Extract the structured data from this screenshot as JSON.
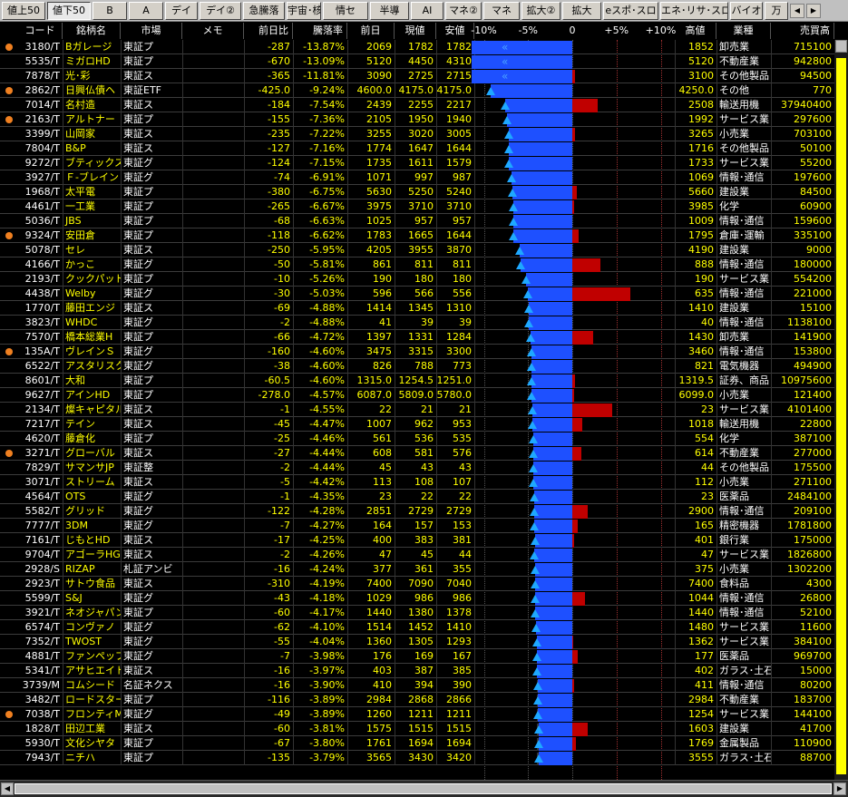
{
  "tabs": [
    "値上50",
    "値下50",
    "B",
    "A",
    "デイ",
    "デイ②",
    "急騰落",
    "宇宙･核",
    "情セ",
    "半導",
    "AI",
    "マネ②",
    "マネ",
    "拡大②",
    "拡大",
    "eスポ･スロ",
    "エネ･リサ･スロ",
    "バイオ",
    "万"
  ],
  "columns": {
    "code": "コード",
    "name": "銘柄名",
    "market": "市場",
    "memo": "メモ",
    "change": "前日比",
    "rate": "騰落率",
    "prev": "前日",
    "now": "現値",
    "low": "安値",
    "axis": [
      "-10%",
      "-5%",
      "0",
      "+5%",
      "+10%"
    ],
    "high": "高値",
    "industry": "業種",
    "volume": "売買高"
  },
  "rows": [
    {
      "dot": true,
      "code": "3180/T",
      "name": "Bガレージ",
      "market": "東証プ",
      "change": "-287",
      "rate": "-13.87%",
      "prev": "2069",
      "now": "1782",
      "low": "1782",
      "high": "1852",
      "industry": "卸売業",
      "volume": "715100",
      "pct": -13.87,
      "hpct": -10.49,
      "mark": "dbl"
    },
    {
      "dot": false,
      "code": "5535/T",
      "name": "ミガロHD",
      "market": "東証プ",
      "change": "-670",
      "rate": "-13.09%",
      "prev": "5120",
      "now": "4450",
      "low": "4310",
      "high": "5120",
      "industry": "不動産業",
      "volume": "942800",
      "pct": -13.09,
      "hpct": 0,
      "mark": "dbl"
    },
    {
      "dot": false,
      "code": "7878/T",
      "name": "光･彩",
      "market": "東証ス",
      "change": "-365",
      "rate": "-11.81%",
      "prev": "3090",
      "now": "2725",
      "low": "2715",
      "high": "3100",
      "industry": "その他製品",
      "volume": "94500",
      "pct": -11.81,
      "hpct": 0.32,
      "mark": "dbl"
    },
    {
      "dot": true,
      "code": "2862/T",
      "name": "日興仏債ヘ",
      "market": "東証ETF",
      "change": "-425.0",
      "rate": "-9.24%",
      "prev": "4600.0",
      "now": "4175.0",
      "low": "4175.0",
      "high": "4250.0",
      "industry": "その他",
      "volume": "770",
      "pct": -9.24,
      "hpct": -7.61,
      "mark": "tri"
    },
    {
      "dot": false,
      "code": "7014/T",
      "name": "名村造",
      "market": "東証ス",
      "change": "-184",
      "rate": "-7.54%",
      "prev": "2439",
      "now": "2255",
      "low": "2217",
      "high": "2508",
      "industry": "輸送用機",
      "volume": "37940400",
      "pct": -7.54,
      "hpct": 2.83,
      "mark": "tri"
    },
    {
      "dot": true,
      "code": "2163/T",
      "name": "アルトナー",
      "market": "東証プ",
      "change": "-155",
      "rate": "-7.36%",
      "prev": "2105",
      "now": "1950",
      "low": "1940",
      "high": "1992",
      "industry": "サービス業",
      "volume": "297600",
      "pct": -7.36,
      "hpct": -5.37,
      "mark": "tri"
    },
    {
      "dot": false,
      "code": "3399/T",
      "name": "山岡家",
      "market": "東証ス",
      "change": "-235",
      "rate": "-7.22%",
      "prev": "3255",
      "now": "3020",
      "low": "3005",
      "high": "3265",
      "industry": "小売業",
      "volume": "703100",
      "pct": -7.22,
      "hpct": 0.31,
      "mark": "tri"
    },
    {
      "dot": false,
      "code": "7804/T",
      "name": "B&P",
      "market": "東証ス",
      "change": "-127",
      "rate": "-7.16%",
      "prev": "1774",
      "now": "1647",
      "low": "1644",
      "high": "1716",
      "industry": "その他製品",
      "volume": "50100",
      "pct": -7.16,
      "hpct": -3.27,
      "mark": "tri"
    },
    {
      "dot": false,
      "code": "9272/T",
      "name": "ブティックス",
      "market": "東証グ",
      "change": "-124",
      "rate": "-7.15%",
      "prev": "1735",
      "now": "1611",
      "low": "1579",
      "high": "1733",
      "industry": "サービス業",
      "volume": "55200",
      "pct": -7.15,
      "hpct": -0.12,
      "mark": "tri"
    },
    {
      "dot": false,
      "code": "3927/T",
      "name": "Ｆ-ブレイン",
      "market": "東証グ",
      "change": "-74",
      "rate": "-6.91%",
      "prev": "1071",
      "now": "997",
      "low": "987",
      "high": "1069",
      "industry": "情報･通信",
      "volume": "197600",
      "pct": -6.91,
      "hpct": -0.19,
      "mark": "tri"
    },
    {
      "dot": false,
      "code": "1968/T",
      "name": "太平電",
      "market": "東証プ",
      "change": "-380",
      "rate": "-6.75%",
      "prev": "5630",
      "now": "5250",
      "low": "5240",
      "high": "5660",
      "industry": "建設業",
      "volume": "84500",
      "pct": -6.75,
      "hpct": 0.53,
      "mark": "tri"
    },
    {
      "dot": false,
      "code": "4461/T",
      "name": "一工業",
      "market": "東証プ",
      "change": "-265",
      "rate": "-6.67%",
      "prev": "3975",
      "now": "3710",
      "low": "3710",
      "high": "3985",
      "industry": "化学",
      "volume": "60900",
      "pct": -6.67,
      "hpct": 0.25,
      "mark": "tri"
    },
    {
      "dot": false,
      "code": "5036/T",
      "name": "JBS",
      "market": "東証プ",
      "change": "-68",
      "rate": "-6.63%",
      "prev": "1025",
      "now": "957",
      "low": "957",
      "high": "1009",
      "industry": "情報･通信",
      "volume": "159600",
      "pct": -6.63,
      "hpct": -1.56,
      "mark": "tri"
    },
    {
      "dot": true,
      "code": "9324/T",
      "name": "安田倉",
      "market": "東証プ",
      "change": "-118",
      "rate": "-6.62%",
      "prev": "1783",
      "now": "1665",
      "low": "1644",
      "high": "1795",
      "industry": "倉庫･運輸",
      "volume": "335100",
      "pct": -6.62,
      "hpct": 0.67,
      "mark": "tri"
    },
    {
      "dot": false,
      "code": "5078/T",
      "name": "セレ",
      "market": "東証ス",
      "change": "-250",
      "rate": "-5.95%",
      "prev": "4205",
      "now": "3955",
      "low": "3870",
      "high": "4190",
      "industry": "建設業",
      "volume": "9000",
      "pct": -5.95,
      "hpct": -0.36,
      "mark": "tri"
    },
    {
      "dot": false,
      "code": "4166/T",
      "name": "かっこ",
      "market": "東証グ",
      "change": "-50",
      "rate": "-5.81%",
      "prev": "861",
      "now": "811",
      "low": "811",
      "high": "888",
      "industry": "情報･通信",
      "volume": "180000",
      "pct": -5.81,
      "hpct": 3.14,
      "mark": "tri"
    },
    {
      "dot": false,
      "code": "2193/T",
      "name": "クックパッド",
      "market": "東証プ",
      "change": "-10",
      "rate": "-5.26%",
      "prev": "190",
      "now": "180",
      "low": "180",
      "high": "190",
      "industry": "サービス業",
      "volume": "554200",
      "pct": -5.26,
      "hpct": 0,
      "mark": "tri"
    },
    {
      "dot": false,
      "code": "4438/T",
      "name": "Welby",
      "market": "東証グ",
      "change": "-30",
      "rate": "-5.03%",
      "prev": "596",
      "now": "566",
      "low": "556",
      "high": "635",
      "industry": "情報･通信",
      "volume": "221000",
      "pct": -5.03,
      "hpct": 6.54,
      "mark": "tri"
    },
    {
      "dot": false,
      "code": "1770/T",
      "name": "藤田エンジ",
      "market": "東証ス",
      "change": "-69",
      "rate": "-4.88%",
      "prev": "1414",
      "now": "1345",
      "low": "1310",
      "high": "1410",
      "industry": "建設業",
      "volume": "15100",
      "pct": -4.88,
      "hpct": -0.28,
      "mark": "tri"
    },
    {
      "dot": false,
      "code": "3823/T",
      "name": "WHDC",
      "market": "東証グ",
      "change": "-2",
      "rate": "-4.88%",
      "prev": "41",
      "now": "39",
      "low": "39",
      "high": "40",
      "industry": "情報･通信",
      "volume": "1138100",
      "pct": -4.88,
      "hpct": -2.44,
      "mark": "tri"
    },
    {
      "dot": false,
      "code": "7570/T",
      "name": "橋本総業H",
      "market": "東証プ",
      "change": "-66",
      "rate": "-4.72%",
      "prev": "1397",
      "now": "1331",
      "low": "1284",
      "high": "1430",
      "industry": "卸売業",
      "volume": "141900",
      "pct": -4.72,
      "hpct": 2.36,
      "mark": "tri"
    },
    {
      "dot": true,
      "code": "135A/T",
      "name": "ヴレインＳ",
      "market": "東証グ",
      "change": "-160",
      "rate": "-4.60%",
      "prev": "3475",
      "now": "3315",
      "low": "3300",
      "high": "3460",
      "industry": "情報･通信",
      "volume": "153800",
      "pct": -4.6,
      "hpct": -0.43,
      "mark": "tri"
    },
    {
      "dot": false,
      "code": "6522/T",
      "name": "アスタリスク",
      "market": "東証グ",
      "change": "-38",
      "rate": "-4.60%",
      "prev": "826",
      "now": "788",
      "low": "773",
      "high": "821",
      "industry": "電気機器",
      "volume": "494900",
      "pct": -4.6,
      "hpct": -0.61,
      "mark": "tri"
    },
    {
      "dot": false,
      "code": "8601/T",
      "name": "大和",
      "market": "東証プ",
      "change": "-60.5",
      "rate": "-4.60%",
      "prev": "1315.0",
      "now": "1254.5",
      "low": "1251.0",
      "high": "1319.5",
      "industry": "証券、商品",
      "volume": "10975600",
      "pct": -4.6,
      "hpct": 0.34,
      "mark": "tri"
    },
    {
      "dot": false,
      "code": "9627/T",
      "name": "アインHD",
      "market": "東証プ",
      "change": "-278.0",
      "rate": "-4.57%",
      "prev": "6087.0",
      "now": "5809.0",
      "low": "5780.0",
      "high": "6099.0",
      "industry": "小売業",
      "volume": "121400",
      "pct": -4.57,
      "hpct": 0.2,
      "mark": "tri"
    },
    {
      "dot": false,
      "code": "2134/T",
      "name": "燦キャピタル",
      "market": "東証ス",
      "change": "-1",
      "rate": "-4.55%",
      "prev": "22",
      "now": "21",
      "low": "21",
      "high": "23",
      "industry": "サービス業",
      "volume": "4101400",
      "pct": -4.55,
      "hpct": 4.55,
      "mark": "tri"
    },
    {
      "dot": false,
      "code": "7217/T",
      "name": "テイン",
      "market": "東証ス",
      "change": "-45",
      "rate": "-4.47%",
      "prev": "1007",
      "now": "962",
      "low": "953",
      "high": "1018",
      "industry": "輸送用機",
      "volume": "22800",
      "pct": -4.47,
      "hpct": 1.09,
      "mark": "tri"
    },
    {
      "dot": false,
      "code": "4620/T",
      "name": "藤倉化",
      "market": "東証プ",
      "change": "-25",
      "rate": "-4.46%",
      "prev": "561",
      "now": "536",
      "low": "535",
      "high": "554",
      "industry": "化学",
      "volume": "387100",
      "pct": -4.46,
      "hpct": -1.25,
      "mark": "tri"
    },
    {
      "dot": true,
      "code": "3271/T",
      "name": "グローバル",
      "market": "東証ス",
      "change": "-27",
      "rate": "-4.44%",
      "prev": "608",
      "now": "581",
      "low": "576",
      "high": "614",
      "industry": "不動産業",
      "volume": "277000",
      "pct": -4.44,
      "hpct": 0.99,
      "mark": "tri"
    },
    {
      "dot": false,
      "code": "7829/T",
      "name": "サマンサJP",
      "market": "東証整",
      "change": "-2",
      "rate": "-4.44%",
      "prev": "45",
      "now": "43",
      "low": "43",
      "high": "44",
      "industry": "その他製品",
      "volume": "175500",
      "pct": -4.44,
      "hpct": -2.22,
      "mark": "tri"
    },
    {
      "dot": false,
      "code": "3071/T",
      "name": "ストリーム",
      "market": "東証ス",
      "change": "-5",
      "rate": "-4.42%",
      "prev": "113",
      "now": "108",
      "low": "107",
      "high": "112",
      "industry": "小売業",
      "volume": "271100",
      "pct": -4.42,
      "hpct": -0.88,
      "mark": "tri"
    },
    {
      "dot": false,
      "code": "4564/T",
      "name": "OTS",
      "market": "東証グ",
      "change": "-1",
      "rate": "-4.35%",
      "prev": "23",
      "now": "22",
      "low": "22",
      "high": "23",
      "industry": "医薬品",
      "volume": "2484100",
      "pct": -4.35,
      "hpct": 0,
      "mark": "tri"
    },
    {
      "dot": false,
      "code": "5582/T",
      "name": "グリッド",
      "market": "東証グ",
      "change": "-122",
      "rate": "-4.28%",
      "prev": "2851",
      "now": "2729",
      "low": "2729",
      "high": "2900",
      "industry": "情報･通信",
      "volume": "209100",
      "pct": -4.28,
      "hpct": 1.72,
      "mark": "tri"
    },
    {
      "dot": false,
      "code": "7777/T",
      "name": "3DM",
      "market": "東証グ",
      "change": "-7",
      "rate": "-4.27%",
      "prev": "164",
      "now": "157",
      "low": "153",
      "high": "165",
      "industry": "精密機器",
      "volume": "1781800",
      "pct": -4.27,
      "hpct": 0.61,
      "mark": "tri"
    },
    {
      "dot": false,
      "code": "7161/T",
      "name": "じもとHD",
      "market": "東証ス",
      "change": "-17",
      "rate": "-4.25%",
      "prev": "400",
      "now": "383",
      "low": "381",
      "high": "401",
      "industry": "銀行業",
      "volume": "175000",
      "pct": -4.25,
      "hpct": 0.25,
      "mark": "tri"
    },
    {
      "dot": false,
      "code": "9704/T",
      "name": "アゴーラHG",
      "market": "東証ス",
      "change": "-2",
      "rate": "-4.26%",
      "prev": "47",
      "now": "45",
      "low": "44",
      "high": "47",
      "industry": "サービス業",
      "volume": "1826800",
      "pct": -4.26,
      "hpct": 0,
      "mark": "tri"
    },
    {
      "dot": false,
      "code": "2928/S",
      "name": "RIZAP",
      "market": "札証アンビ",
      "change": "-16",
      "rate": "-4.24%",
      "prev": "377",
      "now": "361",
      "low": "355",
      "high": "375",
      "industry": "小売業",
      "volume": "1302200",
      "pct": -4.24,
      "hpct": -0.53,
      "mark": "tri"
    },
    {
      "dot": false,
      "code": "2923/T",
      "name": "サトウ食品",
      "market": "東証ス",
      "change": "-310",
      "rate": "-4.19%",
      "prev": "7400",
      "now": "7090",
      "low": "7040",
      "high": "7400",
      "industry": "食料品",
      "volume": "4300",
      "pct": -4.19,
      "hpct": 0,
      "mark": "tri"
    },
    {
      "dot": false,
      "code": "5599/T",
      "name": "S&J",
      "market": "東証グ",
      "change": "-43",
      "rate": "-4.18%",
      "prev": "1029",
      "now": "986",
      "low": "986",
      "high": "1044",
      "industry": "情報･通信",
      "volume": "26800",
      "pct": -4.18,
      "hpct": 1.46,
      "mark": "tri"
    },
    {
      "dot": false,
      "code": "3921/T",
      "name": "ネオジャパン",
      "market": "東証プ",
      "change": "-60",
      "rate": "-4.17%",
      "prev": "1440",
      "now": "1380",
      "low": "1378",
      "high": "1440",
      "industry": "情報･通信",
      "volume": "52100",
      "pct": -4.17,
      "hpct": 0,
      "mark": "tri"
    },
    {
      "dot": false,
      "code": "6574/T",
      "name": "コンヴァノ",
      "market": "東証グ",
      "change": "-62",
      "rate": "-4.10%",
      "prev": "1514",
      "now": "1452",
      "low": "1410",
      "high": "1480",
      "industry": "サービス業",
      "volume": "11600",
      "pct": -4.1,
      "hpct": -2.25,
      "mark": "tri"
    },
    {
      "dot": false,
      "code": "7352/T",
      "name": "TWOST",
      "market": "東証グ",
      "change": "-55",
      "rate": "-4.04%",
      "prev": "1360",
      "now": "1305",
      "low": "1293",
      "high": "1362",
      "industry": "サービス業",
      "volume": "384100",
      "pct": -4.04,
      "hpct": 0.15,
      "mark": "tri"
    },
    {
      "dot": false,
      "code": "4881/T",
      "name": "ファンペップ",
      "market": "東証グ",
      "change": "-7",
      "rate": "-3.98%",
      "prev": "176",
      "now": "169",
      "low": "167",
      "high": "177",
      "industry": "医薬品",
      "volume": "969700",
      "pct": -3.98,
      "hpct": 0.57,
      "mark": "tri"
    },
    {
      "dot": false,
      "code": "5341/T",
      "name": "アサヒエイト",
      "market": "東証ス",
      "change": "-16",
      "rate": "-3.97%",
      "prev": "403",
      "now": "387",
      "low": "385",
      "high": "402",
      "industry": "ガラス･土石",
      "volume": "15000",
      "pct": -3.97,
      "hpct": -0.25,
      "mark": "tri"
    },
    {
      "dot": false,
      "code": "3739/M",
      "name": "コムシード",
      "market": "名証ネクス",
      "change": "-16",
      "rate": "-3.90%",
      "prev": "410",
      "now": "394",
      "low": "390",
      "high": "411",
      "industry": "情報･通信",
      "volume": "80200",
      "pct": -3.9,
      "hpct": 0.24,
      "mark": "tri"
    },
    {
      "dot": false,
      "code": "3482/T",
      "name": "ロードスター",
      "market": "東証プ",
      "change": "-116",
      "rate": "-3.89%",
      "prev": "2984",
      "now": "2868",
      "low": "2866",
      "high": "2984",
      "industry": "不動産業",
      "volume": "183700",
      "pct": -3.89,
      "hpct": 0,
      "mark": "tri"
    },
    {
      "dot": true,
      "code": "7038/T",
      "name": "フロンティM",
      "market": "東証グ",
      "change": "-49",
      "rate": "-3.89%",
      "prev": "1260",
      "now": "1211",
      "low": "1211",
      "high": "1254",
      "industry": "サービス業",
      "volume": "144100",
      "pct": -3.89,
      "hpct": -0.48,
      "mark": "tri"
    },
    {
      "dot": false,
      "code": "1828/T",
      "name": "田辺工業",
      "market": "東証ス",
      "change": "-60",
      "rate": "-3.81%",
      "prev": "1575",
      "now": "1515",
      "low": "1515",
      "high": "1603",
      "industry": "建設業",
      "volume": "41700",
      "pct": -3.81,
      "hpct": 1.78,
      "mark": "tri"
    },
    {
      "dot": false,
      "code": "5930/T",
      "name": "文化シヤタ",
      "market": "東証プ",
      "change": "-67",
      "rate": "-3.80%",
      "prev": "1761",
      "now": "1694",
      "low": "1694",
      "high": "1769",
      "industry": "金属製品",
      "volume": "110900",
      "pct": -3.8,
      "hpct": 0.45,
      "mark": "tri"
    },
    {
      "dot": false,
      "code": "7943/T",
      "name": "ニチハ",
      "market": "東証プ",
      "change": "-135",
      "rate": "-3.79%",
      "prev": "3565",
      "now": "3430",
      "low": "3420",
      "high": "3555",
      "industry": "ガラス･土石",
      "volume": "88700",
      "pct": -3.79,
      "hpct": -0.28,
      "mark": "tri"
    }
  ]
}
